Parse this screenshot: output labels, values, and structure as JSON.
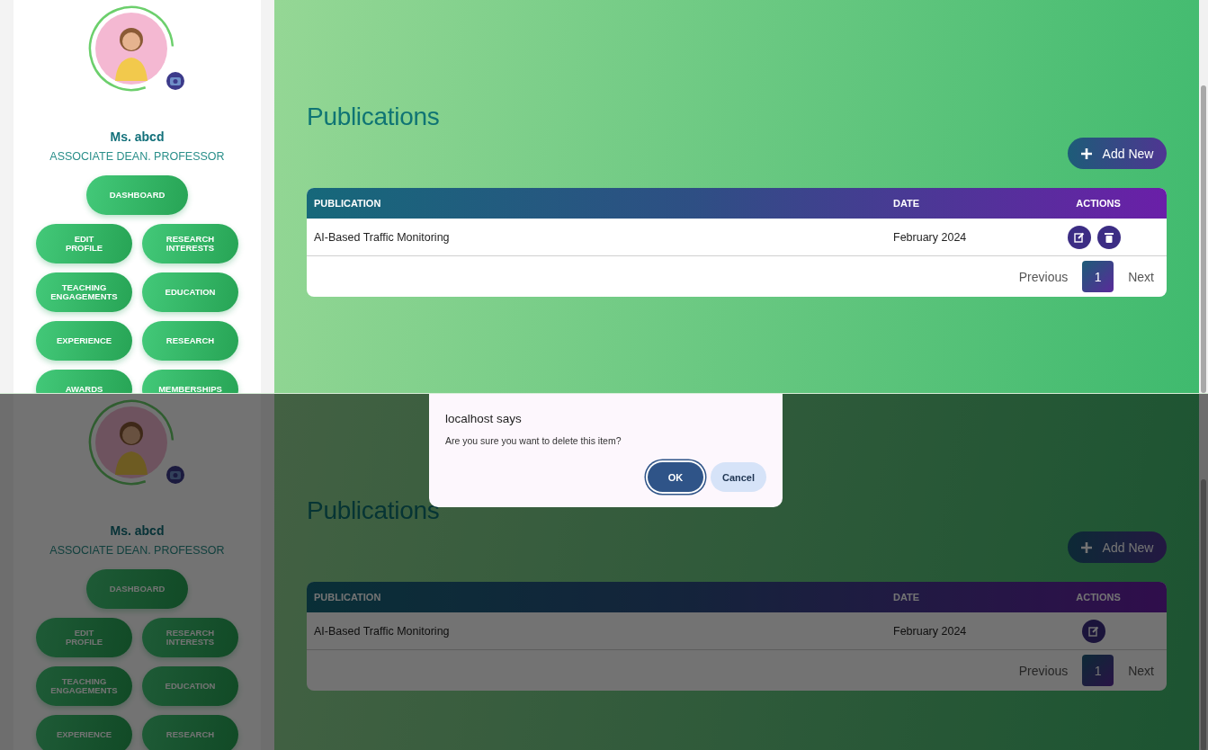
{
  "screens": [
    {
      "profile": {
        "name": "Ms. abcd",
        "role": "ASSOCIATE DEAN. PROFESSOR"
      },
      "nav": [
        {
          "label": "DASHBOARD"
        },
        {
          "label": "EDIT\nPROFILE"
        },
        {
          "label": "RESEARCH\nINTERESTS"
        },
        {
          "label": "TEACHING\nENGAGEMENTS"
        },
        {
          "label": "EDUCATION"
        },
        {
          "label": "EXPERIENCE"
        },
        {
          "label": "RESEARCH"
        },
        {
          "label": "AWARDS"
        },
        {
          "label": "MEMBERSHIPS"
        }
      ],
      "page_title": "Publications",
      "add_button": "Add New",
      "table": {
        "columns": [
          "PUBLICATION",
          "DATE",
          "ACTIONS"
        ],
        "rows": [
          {
            "publication": "AI-Based Traffic Monitoring",
            "date": "February 2024",
            "actions": [
              {
                "kind": "edit"
              },
              {
                "kind": "delete"
              }
            ]
          }
        ]
      },
      "pagination": {
        "previous": "Previous",
        "pages": [
          {
            "label": "1",
            "selected": true
          }
        ],
        "next": "Next"
      }
    },
    {
      "profile": {
        "name": "Ms. abcd",
        "role": "ASSOCIATE DEAN. PROFESSOR"
      },
      "nav": [
        {
          "label": "DASHBOARD"
        },
        {
          "label": "EDIT\nPROFILE"
        },
        {
          "label": "RESEARCH\nINTERESTS"
        },
        {
          "label": "TEACHING\nENGAGEMENTS"
        },
        {
          "label": "EDUCATION"
        },
        {
          "label": "EXPERIENCE"
        },
        {
          "label": "RESEARCH"
        }
      ],
      "page_title": "Publications",
      "add_button": "Add New",
      "table": {
        "columns": [
          "PUBLICATION",
          "DATE",
          "ACTIONS"
        ],
        "rows": [
          {
            "publication": "AI-Based Traffic Monitoring",
            "date": "February 2024",
            "actions": [
              {
                "kind": "edit"
              }
            ]
          }
        ]
      },
      "pagination": {
        "previous": "Previous",
        "pages": [
          {
            "label": "1",
            "selected": true
          }
        ],
        "next": "Next"
      },
      "dialog": {
        "title": "localhost says",
        "message": "Are you sure you want to delete this item?",
        "buttons": [
          {
            "label": "OK",
            "kind": "primary"
          },
          {
            "label": "Cancel",
            "kind": "secondary"
          }
        ]
      }
    }
  ]
}
